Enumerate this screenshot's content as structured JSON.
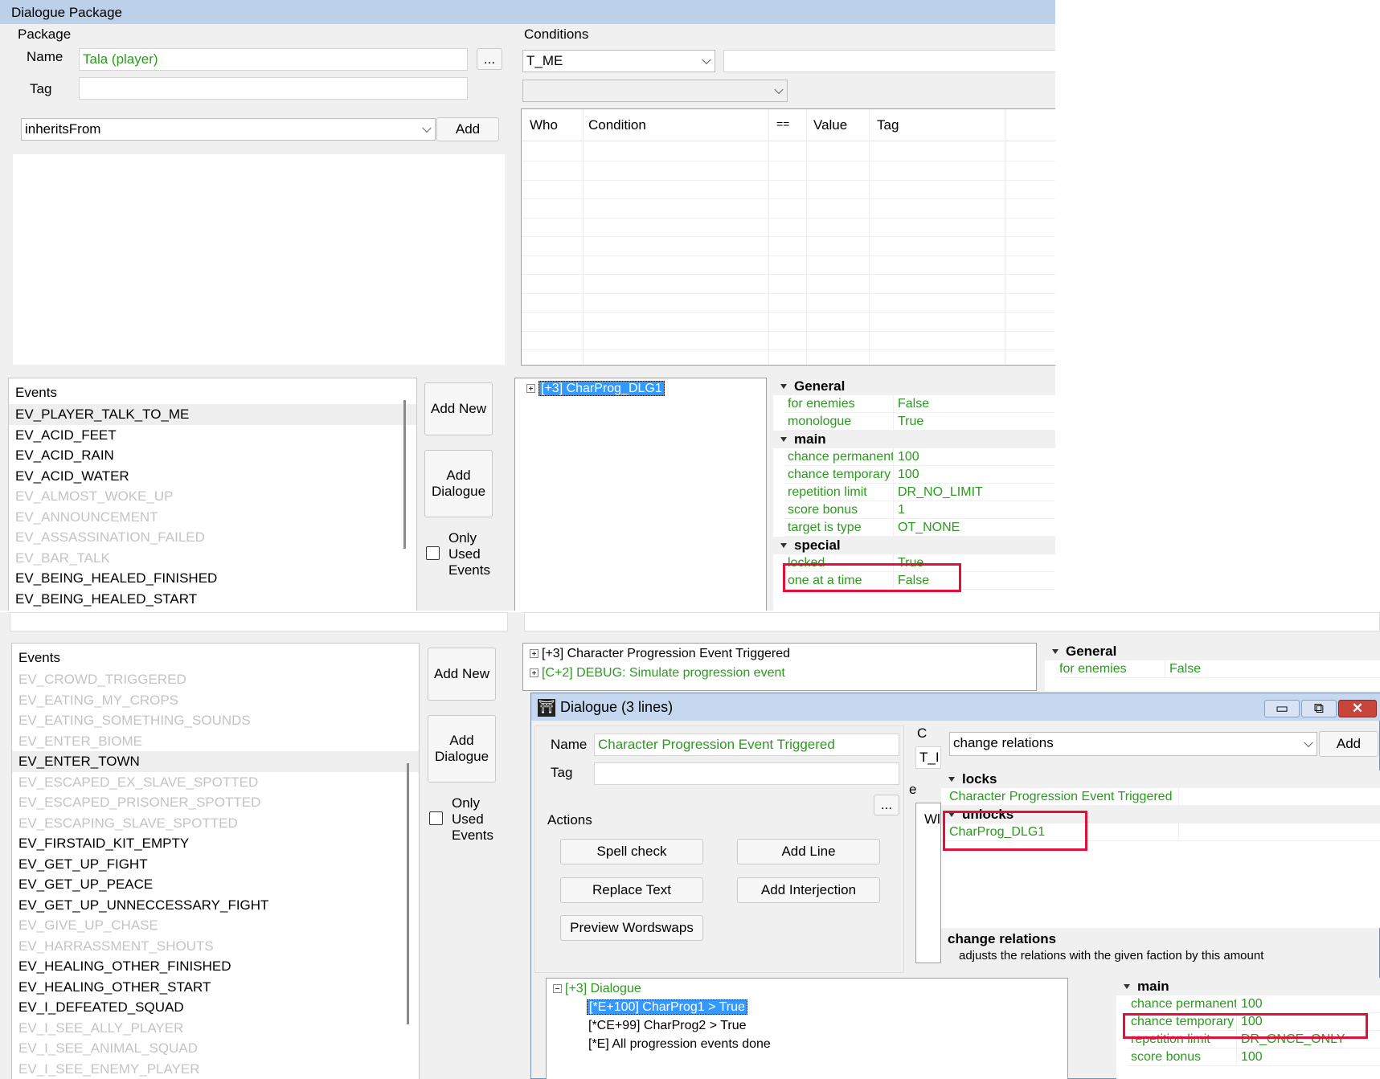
{
  "top": {
    "window_title": "Dialogue Package",
    "package_label": "Package",
    "name_label": "Name",
    "name_value": "Tala (player)",
    "tag_label": "Tag",
    "tag_value": "",
    "dots": "...",
    "inherits": "inheritsFrom",
    "add": "Add",
    "conditions_label": "Conditions",
    "cond_combo": "T_ME",
    "cond_cols": [
      "Who",
      "Condition",
      "==",
      "Value",
      "Tag"
    ],
    "events_header": "Events",
    "events": [
      {
        "t": "EV_PLAYER_TALK_TO_ME",
        "used": true,
        "sel": true
      },
      {
        "t": "EV_ACID_FEET",
        "used": true
      },
      {
        "t": "EV_ACID_RAIN",
        "used": true
      },
      {
        "t": "EV_ACID_WATER",
        "used": true
      },
      {
        "t": "EV_ALMOST_WOKE_UP",
        "used": false
      },
      {
        "t": "EV_ANNOUNCEMENT",
        "used": false
      },
      {
        "t": "EV_ASSASSINATION_FAILED",
        "used": false
      },
      {
        "t": "EV_BAR_TALK",
        "used": false
      },
      {
        "t": "EV_BEING_HEALED_FINISHED",
        "used": true
      },
      {
        "t": "EV_BEING_HEALED_START",
        "used": true
      }
    ],
    "add_new": "Add New",
    "add_dialogue": "Add Dialogue",
    "only_used": "Only Used Events",
    "tree_item": "[+3] CharProg_DLG1",
    "props": {
      "general": "General",
      "general_rows": [
        [
          "for enemies",
          "False"
        ],
        [
          "monologue",
          "True"
        ]
      ],
      "main": "main",
      "main_rows": [
        [
          "chance permanent",
          "100"
        ],
        [
          "chance temporary",
          "100"
        ],
        [
          "repetition limit",
          "DR_NO_LIMIT"
        ],
        [
          "score bonus",
          "1"
        ],
        [
          "target is type",
          "OT_NONE"
        ]
      ],
      "special": "special",
      "special_rows": [
        [
          "locked",
          "True"
        ],
        [
          "one at a time",
          "False"
        ]
      ]
    }
  },
  "bottom": {
    "events_header": "Events",
    "events": [
      {
        "t": "EV_CROWD_TRIGGERED",
        "used": false
      },
      {
        "t": "EV_EATING_MY_CROPS",
        "used": false
      },
      {
        "t": "EV_EATING_SOMETHING_SOUNDS",
        "used": false
      },
      {
        "t": "EV_ENTER_BIOME",
        "used": false
      },
      {
        "t": "EV_ENTER_TOWN",
        "used": true,
        "sel": true
      },
      {
        "t": "EV_ESCAPED_EX_SLAVE_SPOTTED",
        "used": false
      },
      {
        "t": "EV_ESCAPED_PRISONER_SPOTTED",
        "used": false
      },
      {
        "t": "EV_ESCAPING_SLAVE_SPOTTED",
        "used": false
      },
      {
        "t": "EV_FIRSTAID_KIT_EMPTY",
        "used": true
      },
      {
        "t": "EV_GET_UP_FIGHT",
        "used": true
      },
      {
        "t": "EV_GET_UP_PEACE",
        "used": true
      },
      {
        "t": "EV_GET_UP_UNNECCESSARY_FIGHT",
        "used": true
      },
      {
        "t": "EV_GIVE_UP_CHASE",
        "used": false
      },
      {
        "t": "EV_HARRASSMENT_SHOUTS",
        "used": false
      },
      {
        "t": "EV_HEALING_OTHER_FINISHED",
        "used": true
      },
      {
        "t": "EV_HEALING_OTHER_START",
        "used": true
      },
      {
        "t": "EV_I_DEFEATED_SQUAD",
        "used": true
      },
      {
        "t": "EV_I_SEE_ALLY_PLAYER",
        "used": false
      },
      {
        "t": "EV_I_SEE_ANIMAL_SQUAD",
        "used": false
      },
      {
        "t": "EV_I_SEE_ENEMY_PLAYER",
        "used": false
      }
    ],
    "add_new": "Add New",
    "add_dialogue": "Add Dialogue",
    "only_used": "Only Used Events",
    "tree_items": [
      "[+3] Character Progression Event Triggered",
      "[C+2] DEBUG: Simulate progression event"
    ],
    "general": "General",
    "for_enemies": "for enemies",
    "for_enemies_val": "False"
  },
  "dialog": {
    "title": "Dialogue (3 lines)",
    "name_label": "Name",
    "name_value": "Character Progression Event Triggered",
    "tag_label": "Tag",
    "tag_value": "",
    "dots": "...",
    "actions_label": "Actions",
    "spell_check": "Spell check",
    "add_line": "Add Line",
    "replace_text": "Replace Text",
    "add_interjection": "Add Interjection",
    "preview_wordswaps": "Preview Wordswaps",
    "c_label": "C",
    "c_combo": "T_I",
    "e_label": "e",
    "w_label": "Wl",
    "effect_combo": "change relations",
    "add": "Add",
    "locks": "locks",
    "locks_item": "Character Progression Event Triggered",
    "unlocks": "unlocks",
    "unlocks_item": "CharProg_DLG1",
    "help_title": "change relations",
    "help_text": "adjusts the relations with the given faction by this amount",
    "tree_root": "[+3] Dialogue",
    "tree_lines": [
      "[*E+100] CharProg1 > True",
      "[*CE+99] CharProg2 > True",
      "[*E] All progression events done"
    ],
    "props_main": "main",
    "props_rows": [
      [
        "chance permanent",
        "100"
      ],
      [
        "chance temporary",
        "100"
      ],
      [
        "repetition limit",
        "DR_ONCE_ONLY"
      ],
      [
        "score bonus",
        "100"
      ]
    ]
  }
}
